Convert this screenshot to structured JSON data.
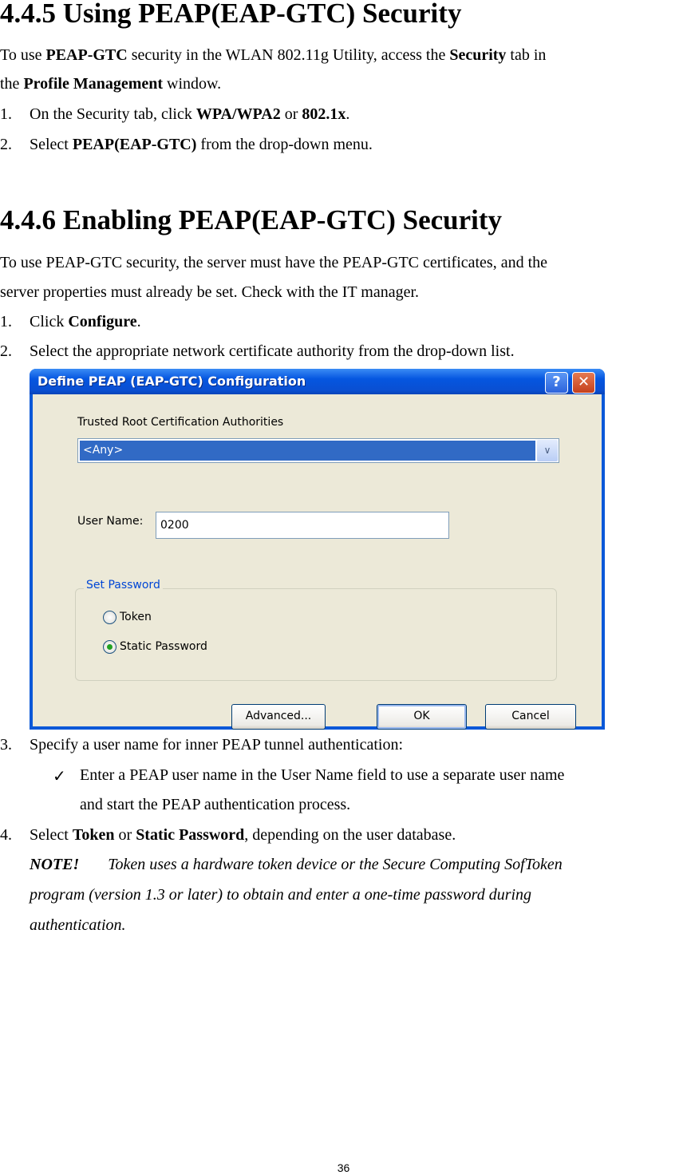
{
  "section1": {
    "heading": "4.4.5 Using PEAP(EAP-GTC) Security",
    "intro_line1": [
      "To use ",
      "PEAP-GTC",
      " security in the WLAN 802.11g Utility, access the ",
      "Security",
      " tab in"
    ],
    "intro_line2": [
      "the ",
      "Profile Management",
      " window."
    ],
    "steps": [
      {
        "num": "1.",
        "parts": [
          "On the Security tab, click ",
          "WPA/WPA2",
          " or ",
          "802.1x",
          "."
        ]
      },
      {
        "num": "2.",
        "parts": [
          "Select ",
          "PEAP(EAP-GTC)",
          " from the drop-down menu."
        ]
      }
    ]
  },
  "section2": {
    "heading": "4.4.6 Enabling PEAP(EAP-GTC) Security",
    "intro_line1": "To use PEAP-GTC security, the server must have the PEAP-GTC certificates, and the",
    "intro_line2": "server properties must already be set. Check with the IT manager.",
    "steps": [
      {
        "num": "1.",
        "parts": [
          "Click ",
          "Configure",
          "."
        ]
      },
      {
        "num": "2.",
        "parts": [
          "Select the appropriate network certificate authority from the drop-down list."
        ]
      },
      {
        "num": "3.",
        "parts": [
          "Specify a user name for inner PEAP tunnel authentication:"
        ]
      },
      {
        "num": "4.",
        "parts": [
          "Select ",
          "Token",
          " or ",
          "Static Password",
          ", depending on the user database."
        ]
      }
    ],
    "check_item": {
      "icon": "✓",
      "line1": "Enter a PEAP user name in the User Name field to use a separate user name",
      "line2": "and start the PEAP authentication process."
    },
    "note": {
      "label": "NOTE!",
      "line1": "Token uses a hardware token device or the Secure Computing SofToken",
      "line2": "program (version 1.3 or later) to obtain and enter a one-time password during",
      "line3": "authentication."
    }
  },
  "dialog": {
    "title": "Define PEAP (EAP-GTC) Configuration",
    "help_glyph": "?",
    "close_glyph": "✕",
    "ca_label": "Trusted Root Certification Authorities",
    "ca_value": "<Any>",
    "dropdown_glyph": "∨",
    "username_label": "User Name:",
    "username_value": "0200",
    "password_group": "Set Password",
    "radio_token": "Token",
    "radio_static": "Static Password",
    "selected_option": "Static Password",
    "advanced_button": "Advanced...",
    "ok_button": "OK",
    "cancel_button": "Cancel"
  },
  "page_number": "36"
}
